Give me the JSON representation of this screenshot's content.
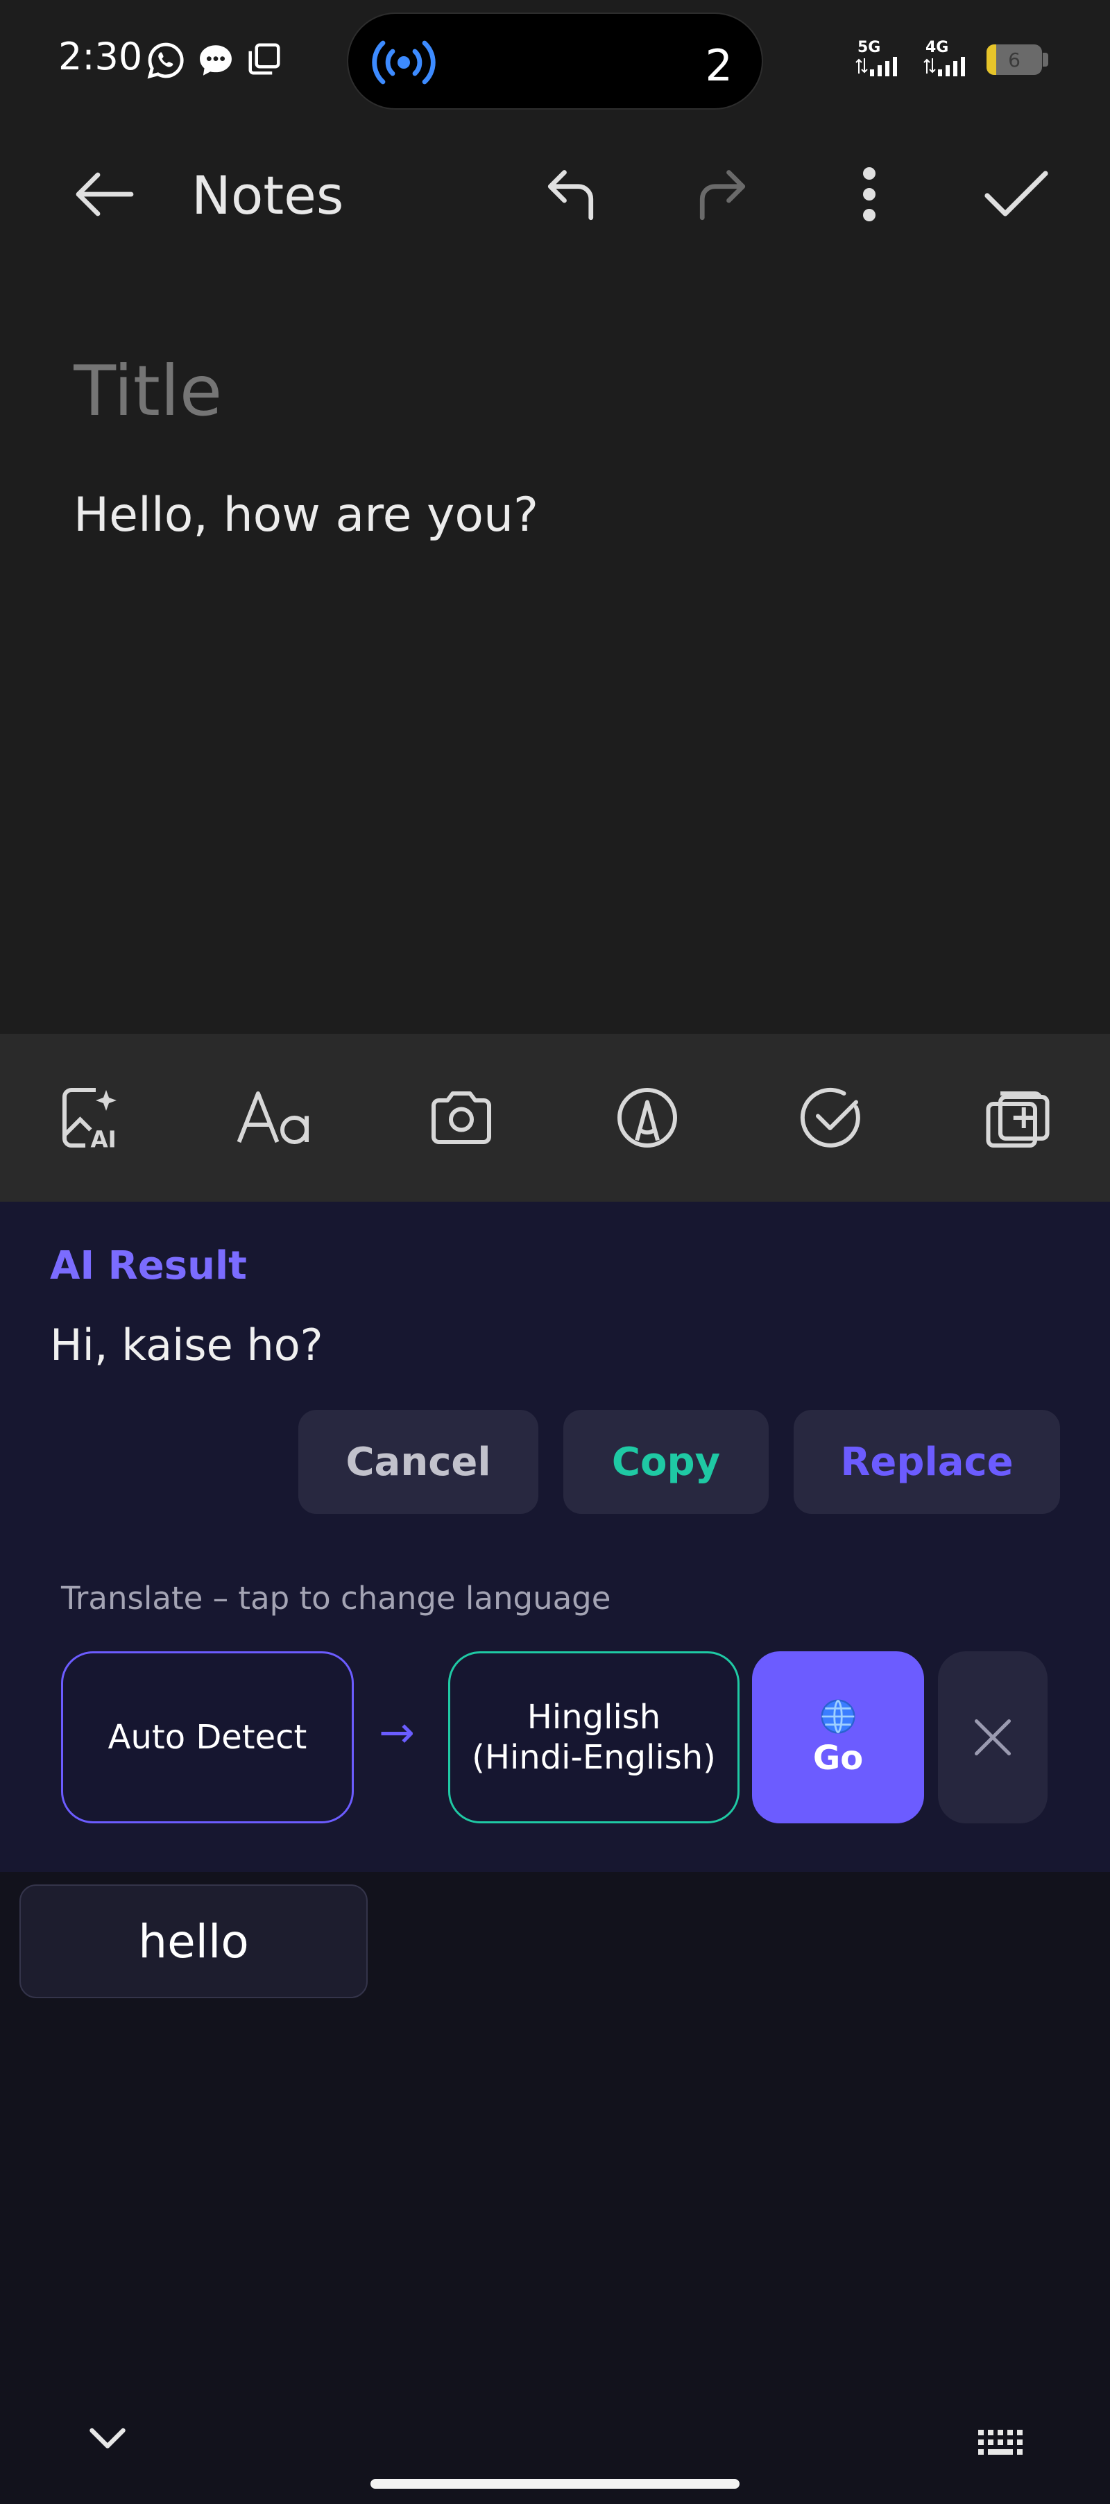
{
  "status_bar": {
    "time": "2:30",
    "island_count": "2",
    "network_1": "5G",
    "network_2": "4G",
    "battery_level": "6"
  },
  "app_bar": {
    "title": "Notes"
  },
  "editor": {
    "title_placeholder": "Title",
    "body_text": "Hello, how are you?"
  },
  "ai_panel": {
    "heading": "AI Result",
    "result_text": "Hi, kaise ho?",
    "buttons": {
      "cancel": "Cancel",
      "copy": "Copy",
      "replace": "Replace"
    },
    "translate_hint": "Translate – tap to change language",
    "source_language": "Auto Detect",
    "arrow": "→",
    "target_language_line1": "Hinglish",
    "target_language_line2": "(Hindi-English)",
    "go_label": "Go",
    "go_icon": "🌐"
  },
  "keyboard": {
    "suggestion": "hello"
  },
  "colors": {
    "accent_purple": "#6c5cff",
    "accent_teal": "#1fc9a4",
    "panel_bg": "#171730",
    "editor_bg": "#1d1d1d"
  },
  "icons": [
    "whatsapp-icon",
    "message-icon",
    "copy-status-icon",
    "broadcast-icon",
    "signal-icon",
    "battery-icon",
    "back-arrow-icon",
    "undo-icon",
    "redo-icon",
    "more-vert-icon",
    "check-icon",
    "ai-image-icon",
    "text-format-icon",
    "camera-icon",
    "pen-icon",
    "checklist-icon",
    "add-copy-icon",
    "close-icon",
    "globe-icon",
    "chevron-down-icon",
    "keyboard-icon"
  ]
}
